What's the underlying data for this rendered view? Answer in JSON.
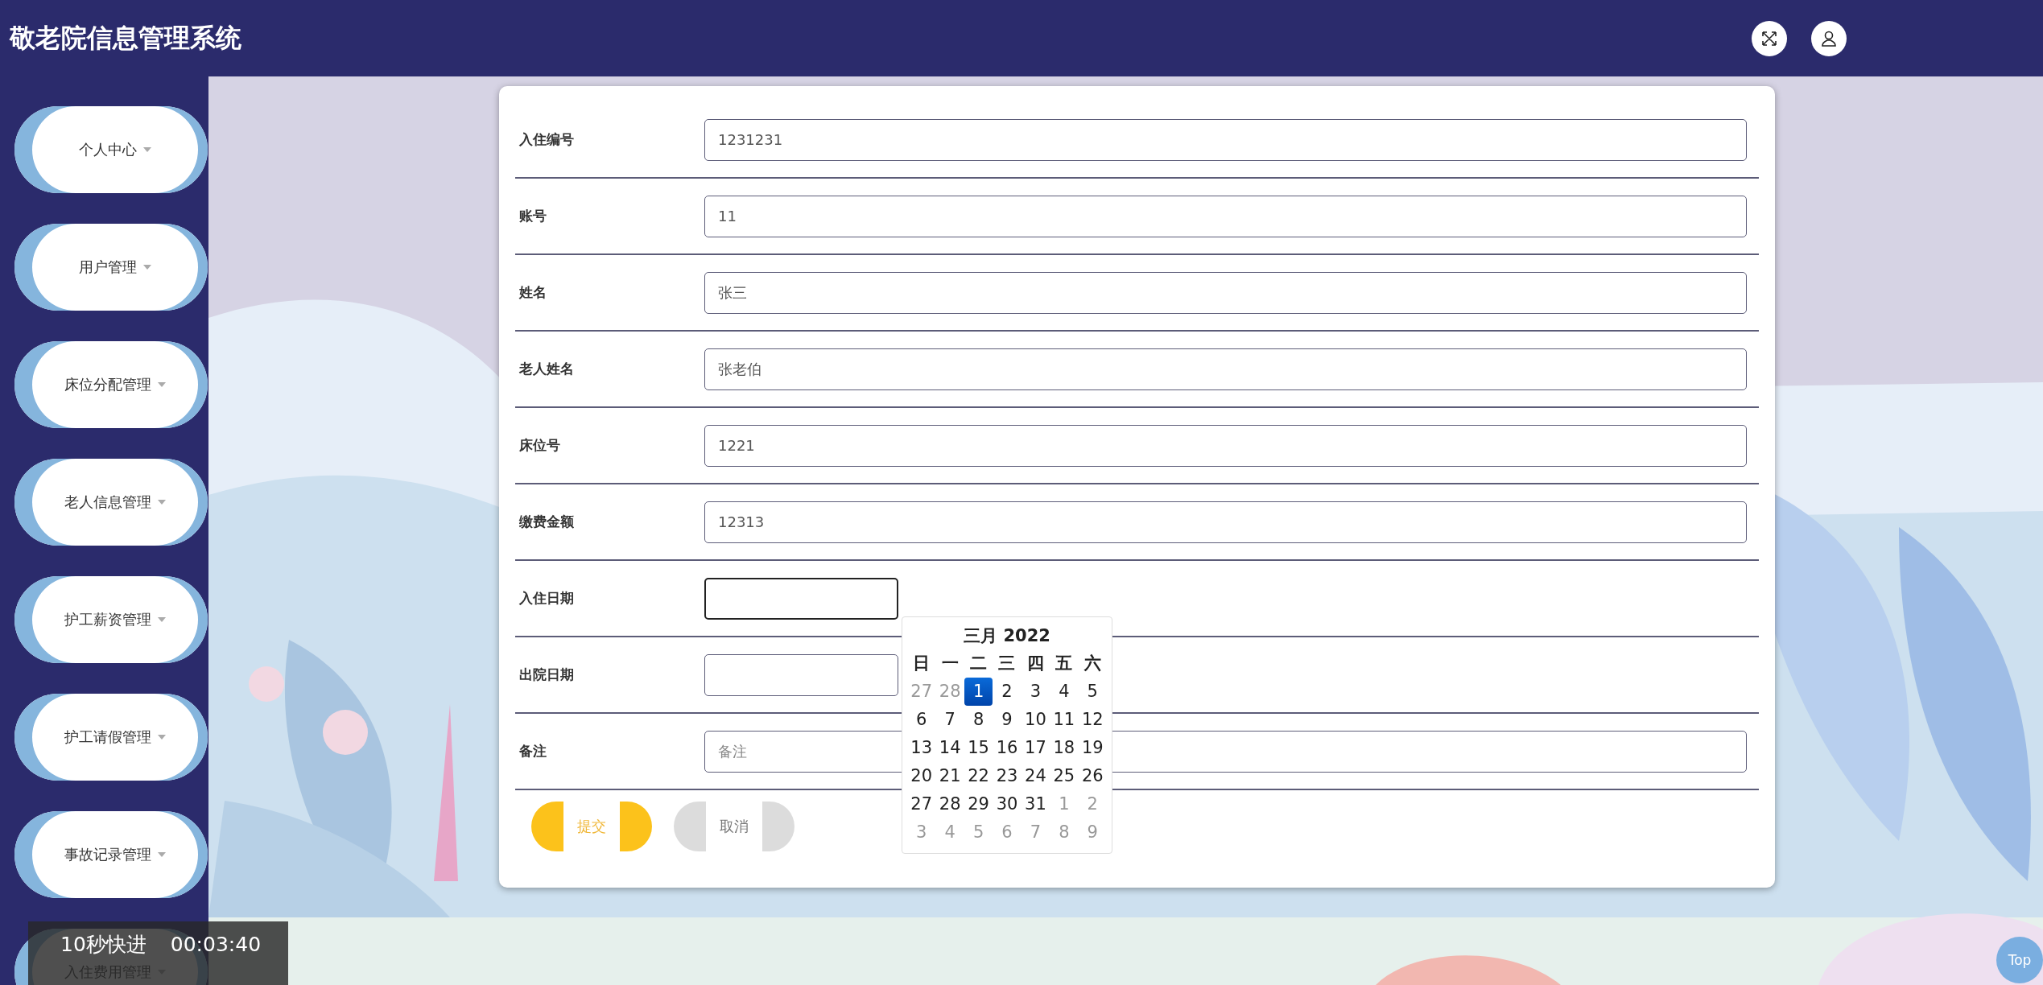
{
  "header": {
    "title": "敬老院信息管理系统"
  },
  "sidebar": {
    "items": [
      {
        "label": "个人中心"
      },
      {
        "label": "用户管理"
      },
      {
        "label": "床位分配管理"
      },
      {
        "label": "老人信息管理"
      },
      {
        "label": "护工薪资管理"
      },
      {
        "label": "护工请假管理"
      },
      {
        "label": "事故记录管理"
      },
      {
        "label": "入住费用管理"
      }
    ]
  },
  "form": {
    "fields": [
      {
        "kind": "text",
        "label": "入住编号",
        "value": "1231231"
      },
      {
        "kind": "text",
        "label": "账号",
        "value": "11"
      },
      {
        "kind": "text",
        "label": "姓名",
        "value": "张三"
      },
      {
        "kind": "text",
        "label": "老人姓名",
        "value": "张老伯"
      },
      {
        "kind": "text",
        "label": "床位号",
        "value": "1221"
      },
      {
        "kind": "text",
        "label": "缴费金额",
        "value": "12313"
      },
      {
        "kind": "date",
        "label": "入住日期",
        "focused": true
      },
      {
        "kind": "date",
        "label": "出院日期",
        "focused": false
      },
      {
        "kind": "text",
        "label": "备注",
        "placeholder": "备注"
      }
    ],
    "buttons": [
      {
        "kind": "submit",
        "label": "提交"
      },
      {
        "kind": "cancel",
        "label": "取消"
      }
    ]
  },
  "calendar": {
    "title": "三月 2022",
    "weekdays": [
      "日",
      "一",
      "二",
      "三",
      "四",
      "五",
      "六"
    ],
    "days": [
      {
        "label": "27",
        "outside": true,
        "selected": false
      },
      {
        "label": "28",
        "outside": true,
        "selected": false
      },
      {
        "label": "1",
        "outside": false,
        "selected": true
      },
      {
        "label": "2",
        "outside": false,
        "selected": false
      },
      {
        "label": "3",
        "outside": false,
        "selected": false
      },
      {
        "label": "4",
        "outside": false,
        "selected": false
      },
      {
        "label": "5",
        "outside": false,
        "selected": false
      },
      {
        "label": "6",
        "outside": false,
        "selected": false
      },
      {
        "label": "7",
        "outside": false,
        "selected": false
      },
      {
        "label": "8",
        "outside": false,
        "selected": false
      },
      {
        "label": "9",
        "outside": false,
        "selected": false
      },
      {
        "label": "10",
        "outside": false,
        "selected": false
      },
      {
        "label": "11",
        "outside": false,
        "selected": false
      },
      {
        "label": "12",
        "outside": false,
        "selected": false
      },
      {
        "label": "13",
        "outside": false,
        "selected": false
      },
      {
        "label": "14",
        "outside": false,
        "selected": false
      },
      {
        "label": "15",
        "outside": false,
        "selected": false
      },
      {
        "label": "16",
        "outside": false,
        "selected": false
      },
      {
        "label": "17",
        "outside": false,
        "selected": false
      },
      {
        "label": "18",
        "outside": false,
        "selected": false
      },
      {
        "label": "19",
        "outside": false,
        "selected": false
      },
      {
        "label": "20",
        "outside": false,
        "selected": false
      },
      {
        "label": "21",
        "outside": false,
        "selected": false
      },
      {
        "label": "22",
        "outside": false,
        "selected": false
      },
      {
        "label": "23",
        "outside": false,
        "selected": false
      },
      {
        "label": "24",
        "outside": false,
        "selected": false
      },
      {
        "label": "25",
        "outside": false,
        "selected": false
      },
      {
        "label": "26",
        "outside": false,
        "selected": false
      },
      {
        "label": "27",
        "outside": false,
        "selected": false
      },
      {
        "label": "28",
        "outside": false,
        "selected": false
      },
      {
        "label": "29",
        "outside": false,
        "selected": false
      },
      {
        "label": "30",
        "outside": false,
        "selected": false
      },
      {
        "label": "31",
        "outside": false,
        "selected": false
      },
      {
        "label": "1",
        "outside": true,
        "selected": false
      },
      {
        "label": "2",
        "outside": true,
        "selected": false
      },
      {
        "label": "3",
        "outside": true,
        "selected": false
      },
      {
        "label": "4",
        "outside": true,
        "selected": false
      },
      {
        "label": "5",
        "outside": true,
        "selected": false
      },
      {
        "label": "6",
        "outside": true,
        "selected": false
      },
      {
        "label": "7",
        "outside": true,
        "selected": false
      },
      {
        "label": "8",
        "outside": true,
        "selected": false
      },
      {
        "label": "9",
        "outside": true,
        "selected": false
      }
    ]
  },
  "video_overlay": {
    "label": "10秒快进",
    "time": "00:03:40"
  },
  "back_to_top": "Top"
}
